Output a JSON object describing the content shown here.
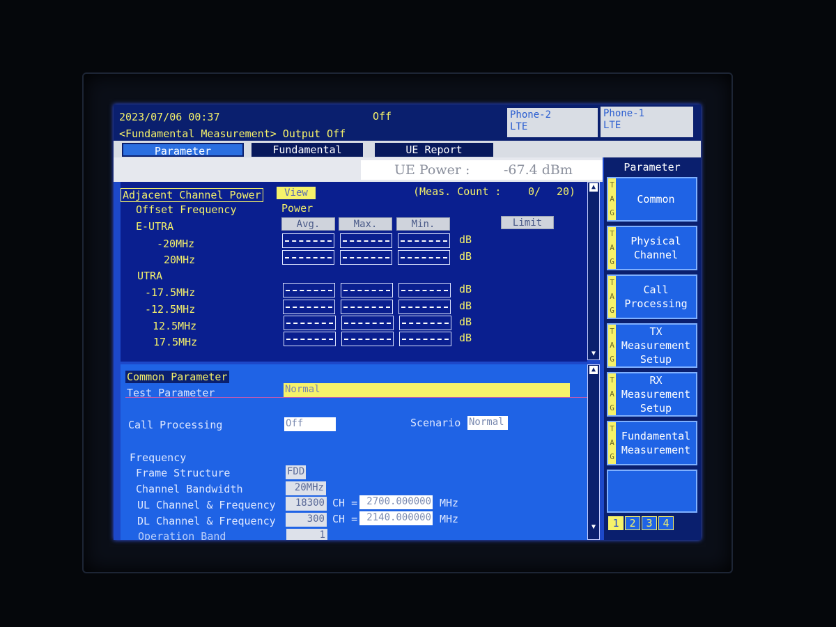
{
  "header": {
    "datetime": "2023/07/06 00:37",
    "output_status": "Off",
    "screen_title": "<Fundamental Measurement> Output Off",
    "phone2": {
      "name": "Phone-2",
      "mode": "LTE"
    },
    "phone1": {
      "name": "Phone-1",
      "mode": "LTE"
    }
  },
  "tabs": [
    {
      "label": "Parameter"
    },
    {
      "label": "Fundamental"
    },
    {
      "label": "UE Report"
    }
  ],
  "ue_power": {
    "label": "UE Power :",
    "value": "-67.4 dBm"
  },
  "acp": {
    "title": "Adjacent Channel Power",
    "view_label": "View",
    "meas_count_label": "(Meas. Count :",
    "meas_count_value": "0/",
    "meas_count_total": "20)",
    "offset_label": "Offset Frequency",
    "power_label": "Power",
    "col_avg": "Avg.",
    "col_max": "Max.",
    "col_min": "Min.",
    "limit_label": "Limit",
    "eutra_label": "E-UTRA",
    "utra_label": "UTRA",
    "unit": "dB",
    "eutra_rows": [
      {
        "offset": "-20MHz",
        "unit": "dB"
      },
      {
        "offset": "20MHz",
        "unit": "dB"
      }
    ],
    "utra_rows": [
      {
        "offset": "-17.5MHz",
        "unit": "dB"
      },
      {
        "offset": "-12.5MHz",
        "unit": "dB"
      },
      {
        "offset": "12.5MHz",
        "unit": "dB"
      },
      {
        "offset": "17.5MHz",
        "unit": "dB"
      }
    ]
  },
  "common": {
    "title": "Common Parameter",
    "test_parameter_label": "Test Parameter",
    "test_parameter_value": "Normal",
    "call_processing_label": "Call Processing",
    "call_processing_value": "Off",
    "scenario_label": "Scenario",
    "scenario_value": "Normal",
    "frequency_label": "Frequency",
    "frame_structure_label": "Frame Structure",
    "frame_structure_value": "FDD",
    "channel_bw_label": "Channel Bandwidth",
    "channel_bw_value": "20MHz",
    "ul_label": "UL Channel & Frequency",
    "ul_channel": "18300",
    "ul_ch_label": "CH =",
    "ul_freq": "2700.000000",
    "ul_unit": "MHz",
    "dl_label": "DL Channel & Frequency",
    "dl_channel": "300",
    "dl_ch_label": "CH =",
    "dl_freq": "2140.000000",
    "dl_unit": "MHz",
    "operation_band_label": "Operation Band",
    "operation_band_value": "1"
  },
  "right_panel": {
    "title": "Parameter",
    "tag_letters": [
      "T",
      "A",
      "G"
    ],
    "softkeys": [
      {
        "label": "Common"
      },
      {
        "label": "Physical\nChannel"
      },
      {
        "label": "Call\nProcessing"
      },
      {
        "label": "TX\nMeasurement\nSetup"
      },
      {
        "label": "RX\nMeasurement\nSetup"
      },
      {
        "label": "Fundamental\nMeasurement"
      }
    ],
    "pages": [
      "1",
      "2",
      "3",
      "4"
    ]
  },
  "colors": {
    "screen_blue": "#1d48c9",
    "dark_blue": "#0a1f8f",
    "highlight_yellow": "#f6f26a"
  }
}
